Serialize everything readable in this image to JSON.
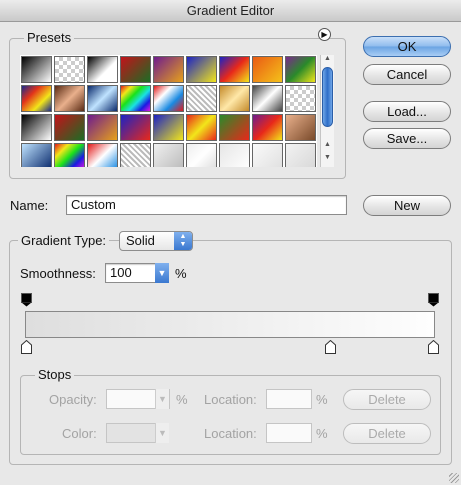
{
  "window": {
    "title": "Gradient Editor"
  },
  "presets": {
    "label": "Presets",
    "swatches": [
      "linear-gradient(135deg,#000,#ffffff)",
      "checker",
      "linear-gradient(135deg,#000,#fff 60%,transparent)",
      "linear-gradient(135deg,#c3121a,#1b6d24)",
      "linear-gradient(135deg,#6e1c8e,#e7a11b)",
      "linear-gradient(135deg,#1b23c4,#f2e61a)",
      "linear-gradient(135deg,#1b23c4,#e8281a,#f2e61a)",
      "linear-gradient(135deg,#ea5a14,#f4c21a)",
      "linear-gradient(135deg,#7a2a8c,#2a8a2a,#f2e61a)",
      "linear-gradient(135deg,#1b2a8c,#e2341a,#f2e61a,#1b2a8c)",
      "linear-gradient(135deg,#5a2a14,#e9b08c,#5a2a14)",
      "linear-gradient(135deg,#0a2a6c,#bfe3ff,#0a2a6c)",
      "linear-gradient(135deg,#e21a1a,#f2e61a,#1ae21a,#1ae2e2,#1a1ae2,#e21ae2)",
      "linear-gradient(135deg,#e21a1a,#fff,#1a8ae2,#e21a1a)",
      "stripes",
      "linear-gradient(135deg,#c48a2a,#ffe8a8,#c48a2a)",
      "linear-gradient(135deg,#444,#fff,#444)",
      "checker",
      "linear-gradient(135deg,#000,#fff)",
      "linear-gradient(135deg,#c3121a,#1b6d24)",
      "linear-gradient(135deg,#6e1c8e,#e7a11b)",
      "linear-gradient(135deg,#1b23c4,#e8281a)",
      "linear-gradient(135deg,#1b23c4,#f2e61a)",
      "linear-gradient(135deg,#e8281a,#f2e61a,#e8281a)",
      "linear-gradient(135deg,#2a8a2a,#e8281a)",
      "linear-gradient(135deg,#6e1c8e,#e8281a,#f2e61a)",
      "linear-gradient(135deg,#e8b08c,#7a4a2a)",
      "linear-gradient(135deg,#bfe3ff,#0a2a6c)",
      "linear-gradient(135deg,#e21a1a,#f2e61a,#1ae21a,#1a1ae2,#e21ae2)",
      "linear-gradient(135deg,#e21a1a,#fff,#1a8ae2)",
      "stripes",
      "linear-gradient(135deg,#f0f0f0,#bbb)",
      "linear-gradient(135deg,#eee,#fff,#ddd)",
      "linear-gradient(135deg,#e6e6e6,#fff)",
      "linear-gradient(135deg,#fafafa,#e0e0e0)",
      "linear-gradient(135deg,#f2f2f2,#d8d8d8)"
    ]
  },
  "buttons": {
    "ok": "OK",
    "cancel": "Cancel",
    "load": "Load...",
    "save": "Save...",
    "new": "New",
    "delete1": "Delete",
    "delete2": "Delete"
  },
  "name": {
    "label": "Name:",
    "value": "Custom"
  },
  "gradient_type": {
    "legend": "Gradient Type:",
    "selected": "Solid",
    "smoothness_label": "Smoothness:",
    "smoothness_value": "100",
    "percent": "%"
  },
  "gradient": {
    "start_color": "#dedede",
    "end_color": "#fefefe"
  },
  "stops": {
    "legend": "Stops",
    "opacity_label": "Opacity:",
    "opacity_value": "",
    "opacity_unit": "%",
    "location_label1": "Location:",
    "location_value1": "",
    "location_unit1": "%",
    "color_label": "Color:",
    "location_label2": "Location:",
    "location_value2": "",
    "location_unit2": "%"
  }
}
